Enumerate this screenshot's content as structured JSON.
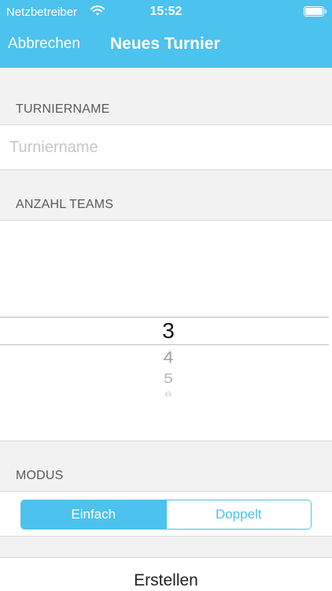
{
  "status_bar": {
    "carrier": "Netzbetreiber",
    "time": "15:52"
  },
  "nav": {
    "cancel_label": "Abbrechen",
    "title": "Neues Turnier"
  },
  "tournament_name": {
    "header": "TURNIERNAME",
    "placeholder": "Turniername",
    "value": ""
  },
  "team_count": {
    "header": "ANZAHL TEAMS",
    "selected": "3",
    "options_below": [
      "4",
      "5",
      "6"
    ]
  },
  "mode": {
    "header": "MODUS",
    "options": [
      "Einfach",
      "Doppelt"
    ],
    "selected": "Einfach"
  },
  "create_label": "Erstellen",
  "colors": {
    "accent": "#4cc2ee",
    "background": "#f2f2f2"
  },
  "icons": [
    "wifi-icon",
    "battery-icon"
  ]
}
